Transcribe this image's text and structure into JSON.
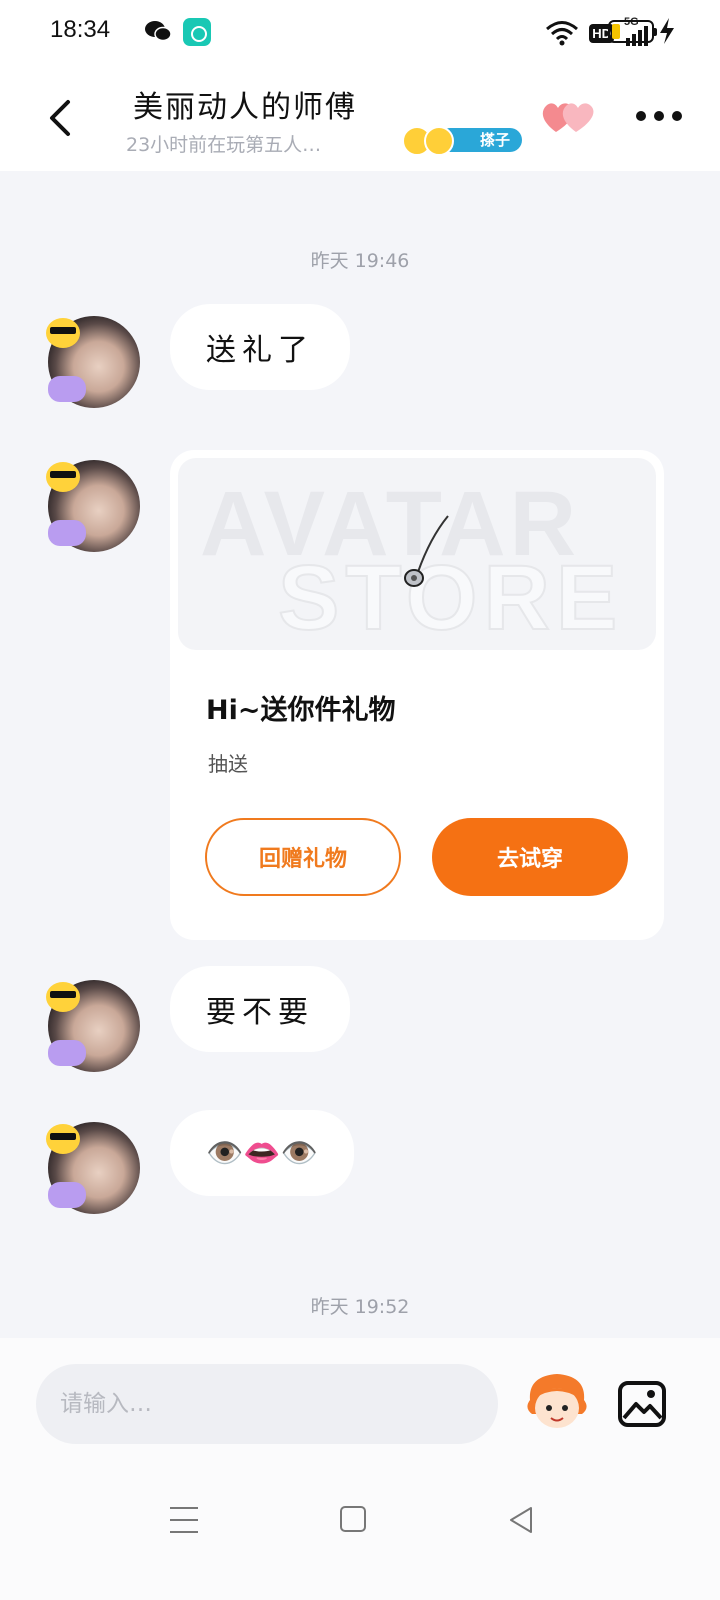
{
  "status_bar": {
    "time": "18:34",
    "wechat_icon": "wechat-icon",
    "app_icon": "music-app-icon",
    "hd_label": "HD",
    "network_label": "5G",
    "battery_level": 0.15,
    "charging": true
  },
  "header": {
    "title": "美丽动人的师傅",
    "subtitle": "23小时前在玩第五人…",
    "game_tag": "搽子",
    "back_icon": "back-arrow-icon",
    "hearts_icon": "hearts-icon",
    "more_icon": "more-dots-icon"
  },
  "chat": {
    "timestamp1": "昨天 19:46",
    "msg1": "送礼了",
    "gift_card": {
      "watermark_line1": "AVATAR",
      "watermark_line2": "STORE",
      "title": "Hi~送你件礼物",
      "subtitle": "抽送",
      "return_gift_label": "回赠礼物",
      "try_on_label": "去试穿"
    },
    "msg2": "要不要",
    "msg3": "👁️👄👁️",
    "timestamp2": "昨天 19:52"
  },
  "input_bar": {
    "placeholder": "请输入…",
    "sticker_icon": "sticker-icon",
    "image_icon": "image-icon"
  },
  "nav_bar": {
    "menu_icon": "menu-icon",
    "home_icon": "home-icon",
    "back_icon": "nav-back-icon"
  },
  "colors": {
    "accent": "#f57113",
    "background": "#f4f5f9",
    "tag_blue": "#2aa7d8"
  }
}
